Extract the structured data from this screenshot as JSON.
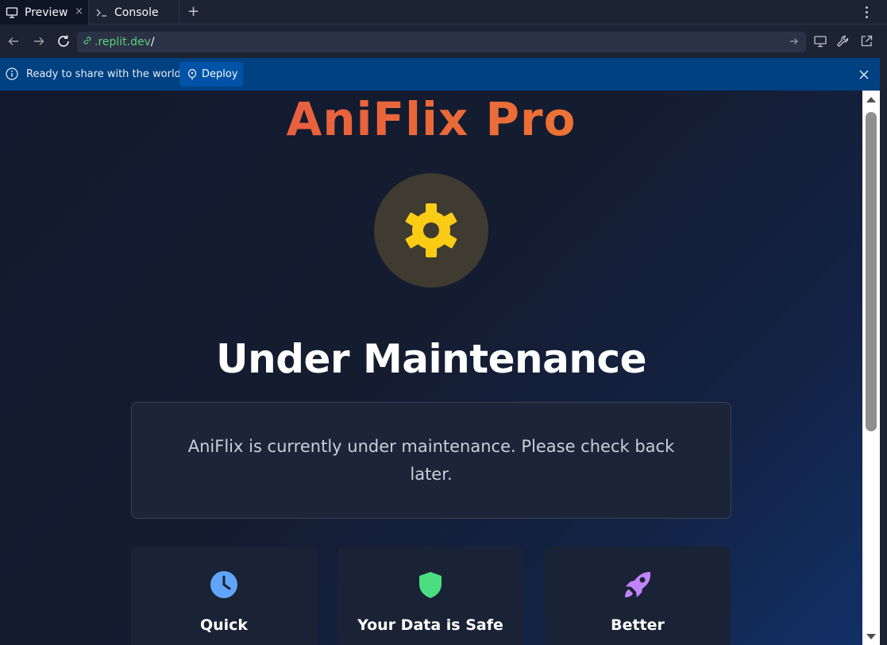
{
  "tabs": [
    {
      "label": "Preview",
      "icon": "monitor-icon",
      "active": true
    },
    {
      "label": "Console",
      "icon": "terminal-icon",
      "active": false
    }
  ],
  "tab_close_glyph": "×",
  "new_tab_glyph": "+",
  "url": {
    "domain": ".replit.dev",
    "path": "/"
  },
  "banner": {
    "text": "Ready to share with the world?",
    "deploy_label": "Deploy"
  },
  "page": {
    "logo": "AniFlix Pro",
    "heading": "Under Maintenance",
    "message": "AniFlix is currently under maintenance. Please check back later.",
    "features": [
      {
        "title": "Quick",
        "icon": "clock-icon",
        "color": "#60a5fa"
      },
      {
        "title": "Your Data is Safe",
        "icon": "shield-icon",
        "color": "#4ade80"
      },
      {
        "title": "Better",
        "icon": "rocket-icon",
        "color": "#c084fc"
      }
    ]
  },
  "colors": {
    "gear": "#facc15",
    "banner": "#004182",
    "url_domain": "#5ad17d"
  }
}
